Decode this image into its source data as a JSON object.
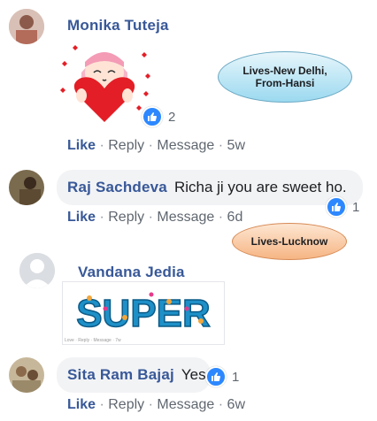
{
  "comments": [
    {
      "author": "Monika Tuteja",
      "text": "",
      "reaction_count": "2",
      "actions": {
        "like": "Like",
        "reply": "Reply",
        "message": "Message",
        "time": "5w"
      },
      "sticker": "heart-girl-sticker"
    },
    {
      "author": "Raj Sachdeva",
      "text": "Richa ji you are sweet ho.",
      "reaction_count": "1",
      "actions": {
        "like": "Like",
        "reply": "Reply",
        "message": "Message",
        "time": "6d"
      }
    },
    {
      "author": "Vandana Jedia",
      "text": "",
      "image_text": "SUPER",
      "image_caption": "Love · Reply · Message · 7w",
      "actions": {}
    },
    {
      "author": "Sita Ram Bajaj",
      "text": "Yes",
      "reaction_count": "1",
      "actions": {
        "like": "Like",
        "reply": "Reply",
        "message": "Message",
        "time": "6w"
      }
    }
  ],
  "callouts": {
    "first": "Lives-New Delhi,\nFrom-Hansi",
    "second": "Lives-Lucknow"
  },
  "colors": {
    "link": "#385898",
    "bubble": "#f2f3f5",
    "like_badge": "#2d88ff"
  }
}
